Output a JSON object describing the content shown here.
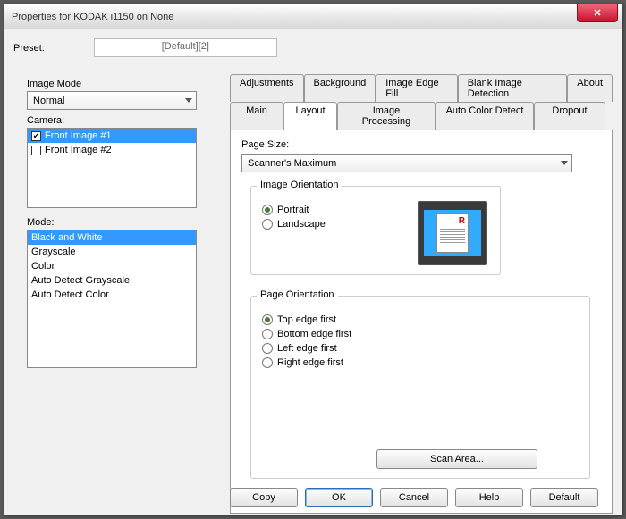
{
  "window": {
    "title": "Properties for KODAK i1150 on None"
  },
  "preset": {
    "label": "Preset:",
    "value": "[Default][2]"
  },
  "left": {
    "imageMode": {
      "label": "Image Mode",
      "value": "Normal"
    },
    "camera": {
      "label": "Camera:",
      "items": [
        "Front Image #1",
        "Front Image #2"
      ],
      "selectedIndex": 0,
      "checked": [
        true,
        false
      ]
    },
    "mode": {
      "label": "Mode:",
      "items": [
        "Black and White",
        "Grayscale",
        "Color",
        "Auto Detect Grayscale",
        "Auto Detect Color"
      ],
      "selectedIndex": 0
    }
  },
  "tabs": {
    "row1": [
      "Adjustments",
      "Background",
      "Image Edge Fill",
      "Blank Image Detection",
      "About"
    ],
    "row2": [
      "Main",
      "Layout",
      "Image Processing",
      "Auto Color Detect",
      "Dropout"
    ],
    "active": "Layout"
  },
  "layout": {
    "pageSize": {
      "label": "Page Size:",
      "value": "Scanner's Maximum"
    },
    "imageOrientation": {
      "legend": "Image Orientation",
      "options": [
        "Portrait",
        "Landscape"
      ],
      "selected": "Portrait"
    },
    "pageOrientation": {
      "legend": "Page Orientation",
      "options": [
        "Top edge first",
        "Bottom edge first",
        "Left edge first",
        "Right edge first"
      ],
      "selected": "Top edge first"
    },
    "scanArea": "Scan Area..."
  },
  "buttons": {
    "copy": "Copy",
    "ok": "OK",
    "cancel": "Cancel",
    "help": "Help",
    "default": "Default"
  }
}
